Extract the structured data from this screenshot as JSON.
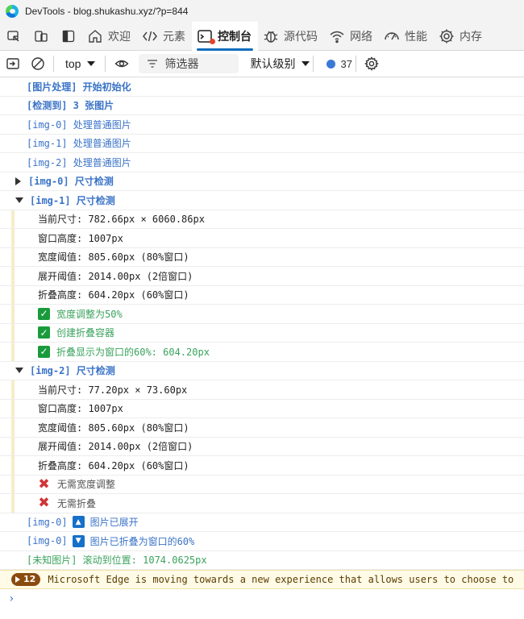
{
  "window": {
    "title": "DevTools - blog.shukashu.xyz/?p=844"
  },
  "tabs": [
    {
      "label": "欢迎"
    },
    {
      "label": "元素"
    },
    {
      "label": "控制台"
    },
    {
      "label": "源代码"
    },
    {
      "label": "网络"
    },
    {
      "label": "性能"
    },
    {
      "label": "内存"
    }
  ],
  "toolbar": {
    "context": "top",
    "filter_placeholder": "筛选器",
    "level": "默认级别",
    "message_count": "37"
  },
  "console": [
    {
      "text": "[图片处理] 开始初始化"
    },
    {
      "text": "[检测到] 3 张图片"
    },
    {
      "text": "[img-0] 处理普通图片"
    },
    {
      "text": "[img-1] 处理普通图片"
    },
    {
      "text": "[img-2] 处理普通图片"
    },
    {
      "text": "[img-0] 尺寸检测"
    },
    {
      "text": "[img-1] 尺寸检测"
    },
    {
      "text": "当前尺寸: 782.66px × 6060.86px"
    },
    {
      "text": "窗口高度: 1007px"
    },
    {
      "text": "宽度阈值: 805.60px (80%窗口)"
    },
    {
      "text": "展开阈值: 2014.00px (2倍窗口)"
    },
    {
      "text": "折叠高度: 604.20px (60%窗口)"
    },
    {
      "text": "宽度调整为50%"
    },
    {
      "text": "创建折叠容器"
    },
    {
      "text": "折叠显示为窗口的60%: 604.20px"
    },
    {
      "text": "[img-2] 尺寸检测"
    },
    {
      "text": "当前尺寸: 77.20px × 73.60px"
    },
    {
      "text": "窗口高度: 1007px"
    },
    {
      "text": "宽度阈值: 805.60px (80%窗口)"
    },
    {
      "text": "展开阈值: 2014.00px (2倍窗口)"
    },
    {
      "text": "折叠高度: 604.20px (60%窗口)"
    },
    {
      "text": "无需宽度调整"
    },
    {
      "text": "无需折叠"
    },
    {
      "prefix": "[img-0]",
      "text": "图片已展开"
    },
    {
      "prefix": "[img-0]",
      "text": "图片已折叠为窗口的60%"
    },
    {
      "text": "[未知图片] 滚动到位置: 1074.0625px"
    }
  ],
  "warning": {
    "count": "12",
    "text": "Microsoft Edge is moving towards a new experience that allows users to choose to"
  },
  "prompt_symbol": "›"
}
